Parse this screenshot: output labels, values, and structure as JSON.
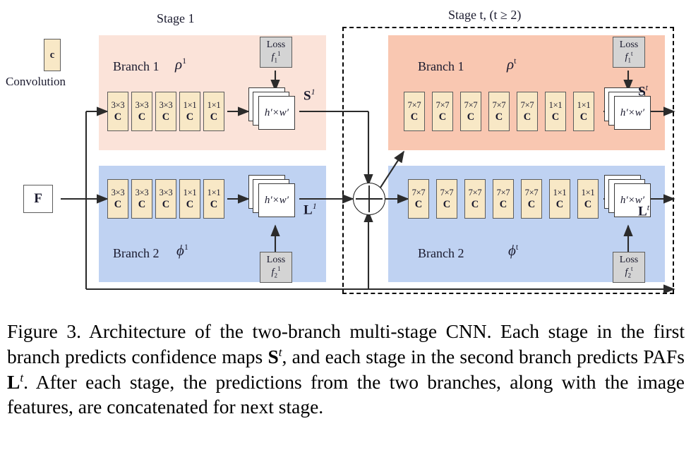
{
  "figure": {
    "legend": {
      "box_label": "c",
      "caption": "Convolution"
    },
    "input": {
      "label": "F"
    },
    "stages": [
      {
        "id": "stage1",
        "title": "Stage 1",
        "dashed": false,
        "branches": [
          {
            "id": "branch1-stage1",
            "name": "Branch 1",
            "symbol": "ρ",
            "symbol_sup": "1",
            "convs": [
              "3×3",
              "3×3",
              "3×3",
              "1×1",
              "1×1"
            ],
            "conv_letter": "C",
            "featuremap": "h′×w′",
            "output": "S",
            "output_sup": "1",
            "loss_label": "Loss",
            "loss_fn": "f",
            "loss_sub": "1",
            "loss_sup": "1",
            "color": "#fbe3d9"
          },
          {
            "id": "branch2-stage1",
            "name": "Branch 2",
            "symbol": "ϕ",
            "symbol_sup": "1",
            "convs": [
              "3×3",
              "3×3",
              "3×3",
              "1×1",
              "1×1"
            ],
            "conv_letter": "C",
            "featuremap": "h′×w′",
            "output": "L",
            "output_sup": "1",
            "loss_label": "Loss",
            "loss_fn": "f",
            "loss_sub": "2",
            "loss_sup": "1",
            "color": "#bfd2f2"
          }
        ]
      },
      {
        "id": "stageT",
        "title": "Stage t, (t ≥ 2)",
        "dashed": true,
        "branches": [
          {
            "id": "branch1-stageT",
            "name": "Branch 1",
            "symbol": "ρ",
            "symbol_sup": "t",
            "convs": [
              "7×7",
              "7×7",
              "7×7",
              "7×7",
              "7×7",
              "1×1",
              "1×1"
            ],
            "conv_letter": "C",
            "featuremap": "h′×w′",
            "output": "S",
            "output_sup": "t",
            "loss_label": "Loss",
            "loss_fn": "f",
            "loss_sub": "1",
            "loss_sup": "t",
            "color": "#f9c7b1"
          },
          {
            "id": "branch2-stageT",
            "name": "Branch 2",
            "symbol": "ϕ",
            "symbol_sup": "t",
            "convs": [
              "7×7",
              "7×7",
              "7×7",
              "7×7",
              "7×7",
              "1×1",
              "1×1"
            ],
            "conv_letter": "C",
            "featuremap": "h′×w′",
            "output": "L",
            "output_sup": "t",
            "loss_label": "Loss",
            "loss_fn": "f",
            "loss_sub": "2",
            "loss_sup": "t",
            "color": "#bfd2f2"
          }
        ]
      }
    ],
    "concat": {
      "symbol": "⊕",
      "name": "concatenation"
    }
  },
  "caption": {
    "prefix": "Figure 3.",
    "text_1": " Architecture of the two-branch multi-stage CNN. Each stage in the first branch predicts confidence maps ",
    "sym_s": "S",
    "sym_s_sup": "t",
    "text_2": ", and each stage in the second branch predicts PAFs ",
    "sym_l": "L",
    "sym_l_sup": "t",
    "text_3": ". After each stage, the predictions from the two branches, along with the image features, are concatenated for next stage."
  }
}
